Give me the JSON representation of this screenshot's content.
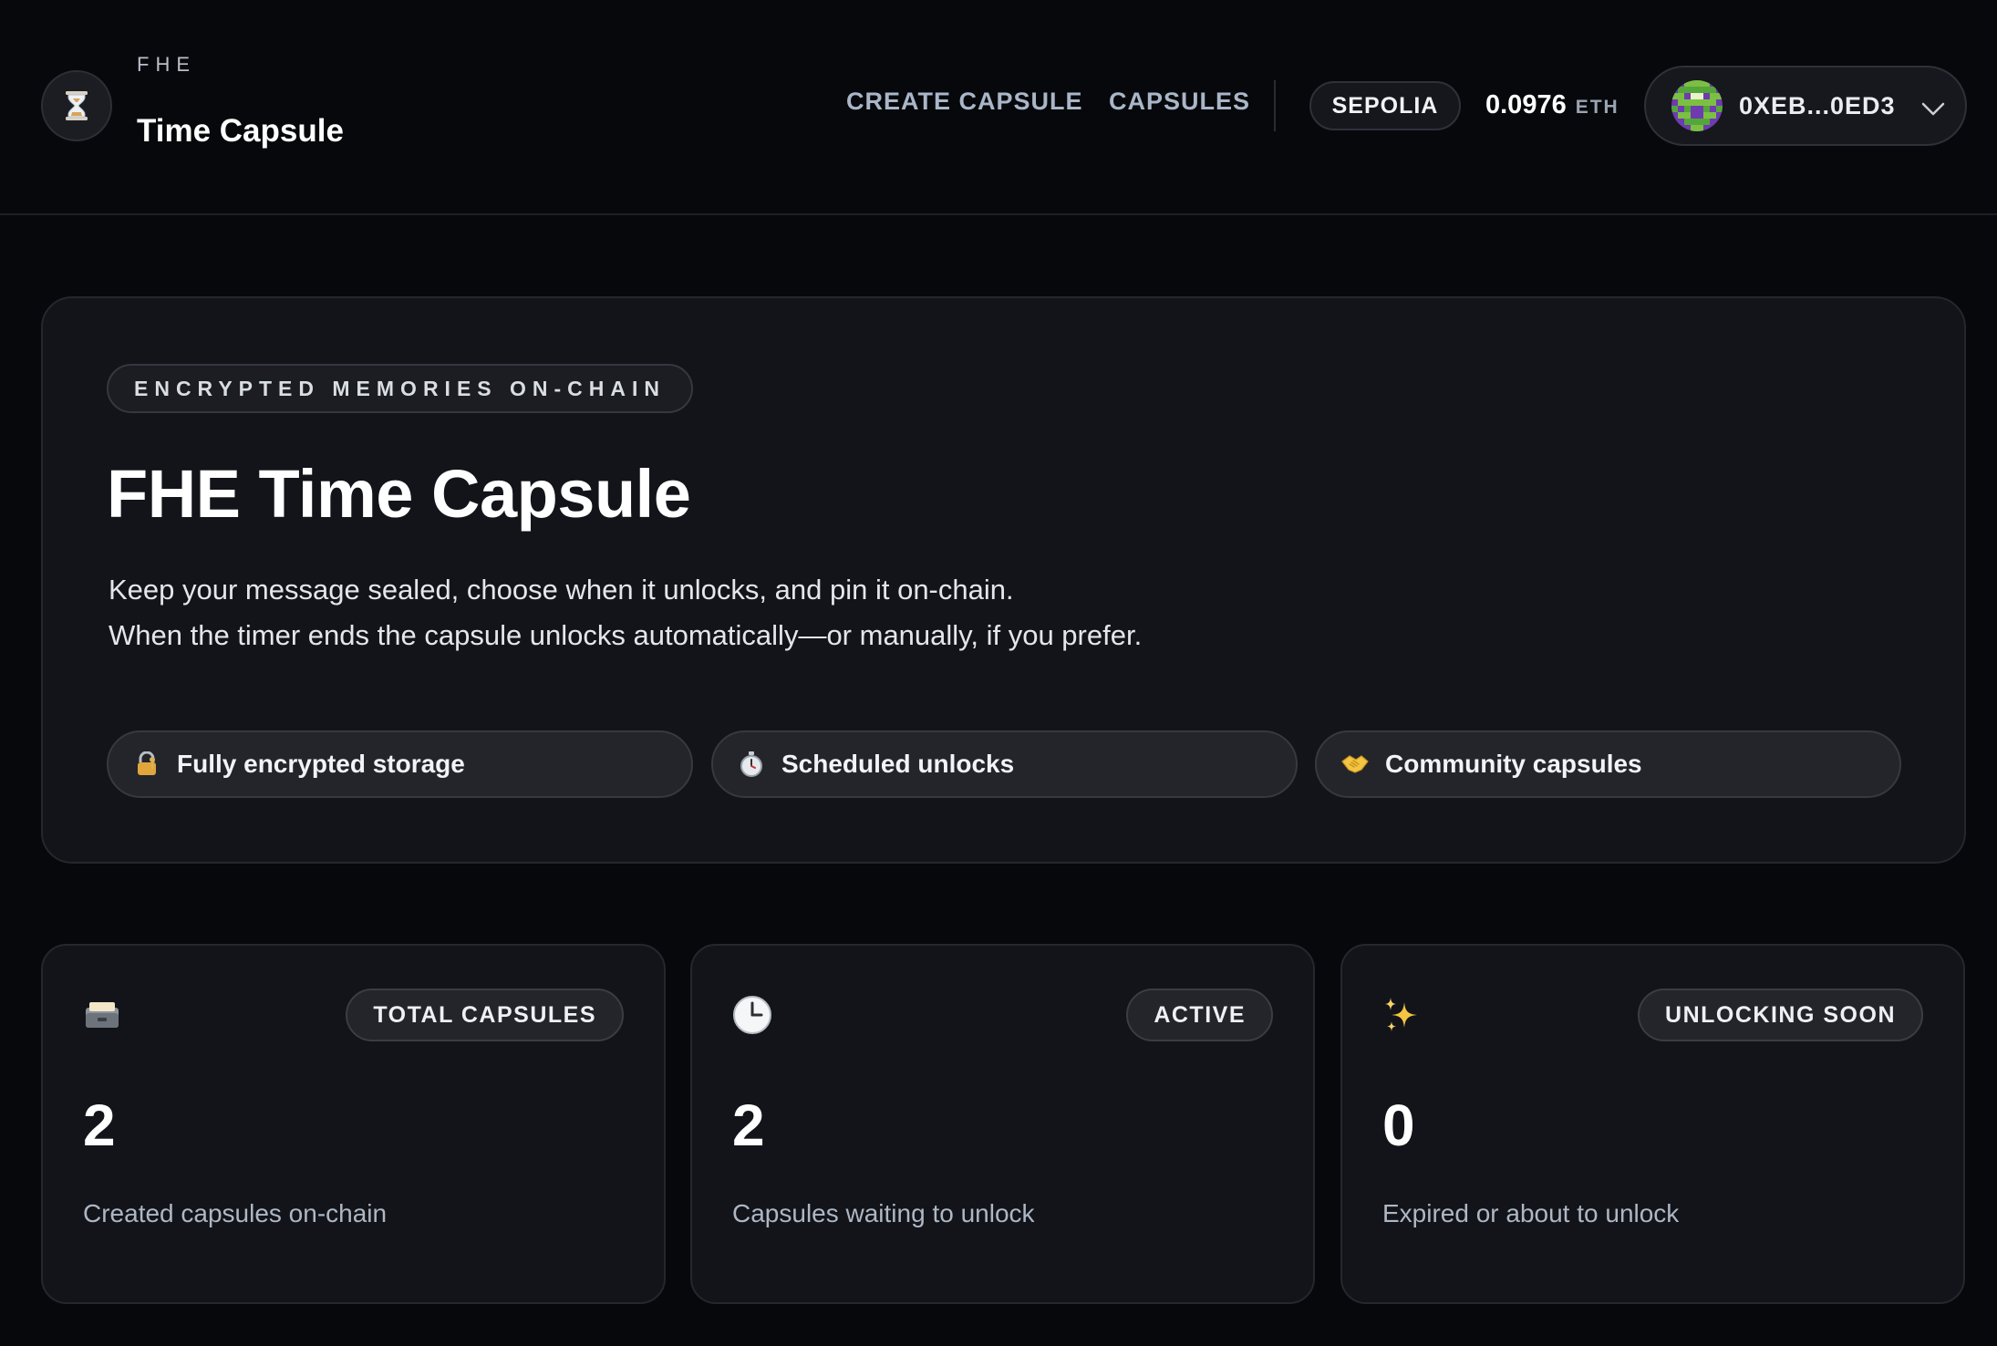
{
  "brand": {
    "kicker": "FHE",
    "title": "Time Capsule",
    "icon": "hourglass-icon"
  },
  "nav": {
    "create": "CREATE CAPSULE",
    "capsules": "CAPSULES"
  },
  "network": {
    "label": "SEPOLIA"
  },
  "wallet": {
    "balance": "0.0976",
    "unit": "ETH",
    "account": "0XEB...0ED3"
  },
  "hero": {
    "kicker": "ENCRYPTED MEMORIES ON-CHAIN",
    "title": "FHE Time Capsule",
    "line1": "Keep your message sealed, choose when it unlocks, and pin it on-chain.",
    "line2": "When the timer ends the capsule unlocks automatically—or manually, if you prefer.",
    "features": [
      {
        "icon": "lock-key-icon",
        "label": "Fully encrypted storage"
      },
      {
        "icon": "stopwatch-icon",
        "label": "Scheduled unlocks"
      },
      {
        "icon": "handshake-icon",
        "label": "Community capsules"
      }
    ]
  },
  "stats": [
    {
      "icon": "card-file-box-icon",
      "badge": "TOTAL CAPSULES",
      "value": "2",
      "caption": "Created capsules on-chain"
    },
    {
      "icon": "clock-icon",
      "badge": "ACTIVE",
      "value": "2",
      "caption": "Capsules waiting to unlock"
    },
    {
      "icon": "sparkles-icon",
      "badge": "UNLOCKING SOON",
      "value": "0",
      "caption": "Expired or about to unlock"
    }
  ],
  "colors": {
    "background": "#07080b",
    "card": "#121419",
    "accent_text": "#a9b6c8"
  }
}
